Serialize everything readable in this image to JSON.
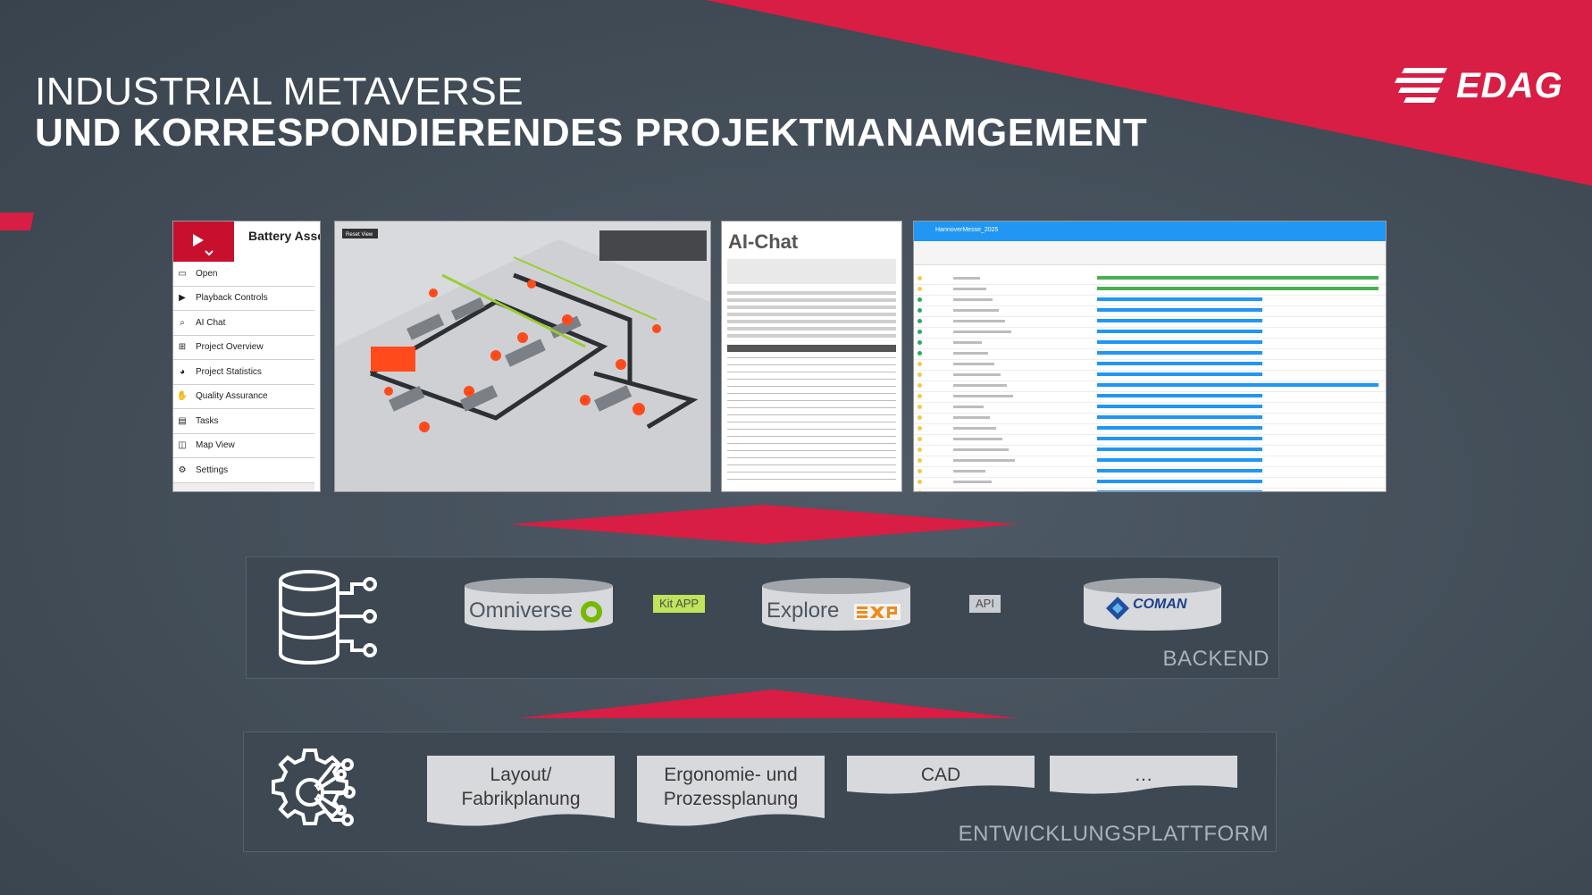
{
  "title": {
    "line1": "INDUSTRIAL METAVERSE",
    "line2": "UND KORRESPONDIERENDES PROJEKTMANAMGEMENT"
  },
  "logo": {
    "text": "EDAG"
  },
  "menu_screenshot": {
    "title": "Battery Asse",
    "items": [
      {
        "label": "Open",
        "icon": "folder-icon"
      },
      {
        "label": "Playback Controls",
        "icon": "play-icon"
      },
      {
        "label": "AI Chat",
        "icon": "ai-chat-icon"
      },
      {
        "label": "Project Overview",
        "icon": "overview-icon"
      },
      {
        "label": "Project Statistics",
        "icon": "statistics-icon"
      },
      {
        "label": "Quality Assurance",
        "icon": "thumbs-up-icon"
      },
      {
        "label": "Tasks",
        "icon": "tasks-icon"
      },
      {
        "label": "Map View",
        "icon": "map-icon"
      },
      {
        "label": "Settings",
        "icon": "gear-icon"
      }
    ]
  },
  "viewport_screenshot": {
    "reset_label": "Reset View"
  },
  "ai_screenshot": {
    "title": "AI-Chat"
  },
  "gantt_screenshot": {
    "title": "HannoverMesse_2025"
  },
  "backend": {
    "label": "BACKEND",
    "omniverse": "Omniverse",
    "kit_tag": "Kit APP",
    "explore": "Explore",
    "api_tag": "API",
    "coman": "COMAN"
  },
  "platform": {
    "label": "ENTWICKLUNGSPLATTFORM",
    "docs": [
      {
        "line1": "Layout/",
        "line2": "Fabrikplanung"
      },
      {
        "line1": "Ergonomie- und",
        "line2": "Prozessplanung"
      },
      {
        "line1": "CAD",
        "line2": ""
      },
      {
        "line1": "…",
        "line2": ""
      }
    ]
  },
  "colors": {
    "brand_red": "#d81e44",
    "panel": "#3d4853",
    "background": "#454f5a"
  }
}
